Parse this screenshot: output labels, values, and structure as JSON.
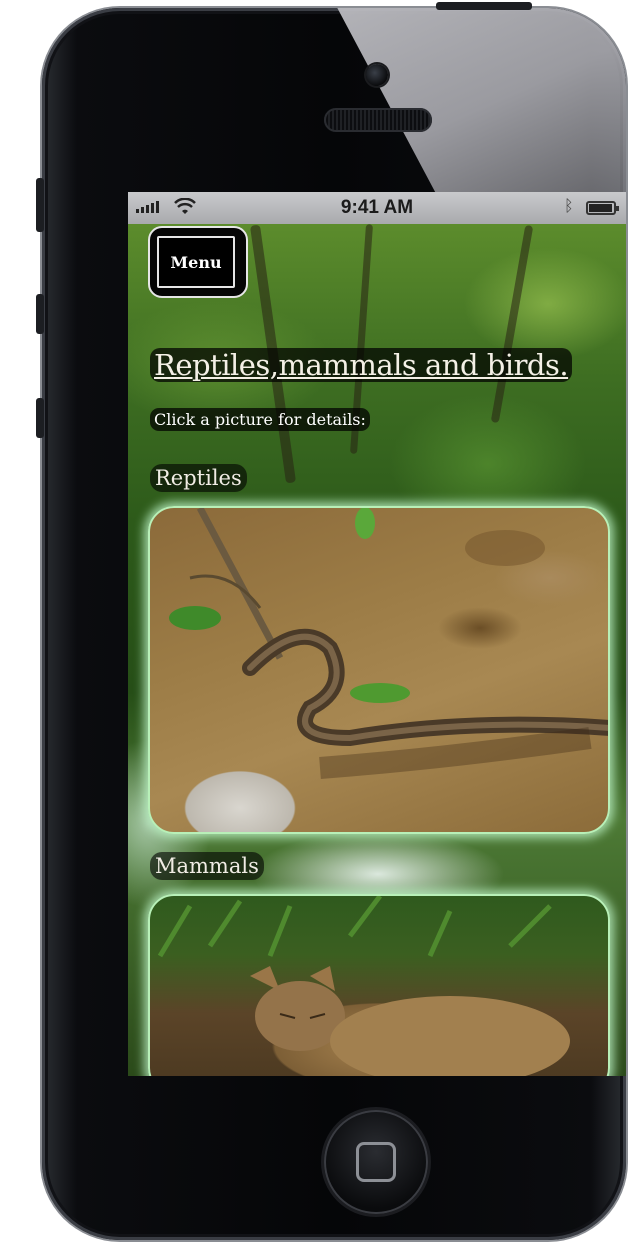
{
  "status_bar": {
    "time": "9:41 AM",
    "signal_bars": 4,
    "battery_level": 0.95
  },
  "menu": {
    "label": "Menu"
  },
  "page": {
    "title": "Reptiles,mammals and birds.",
    "instructions": "Click a picture for details:"
  },
  "sections": [
    {
      "label": "Reptiles",
      "photo": "snake-photo"
    },
    {
      "label": "Mammals",
      "photo": "cat-photo"
    }
  ],
  "colors": {
    "card_border": "#b8f0b8",
    "label_background": "#000000",
    "text": "#ffffff"
  },
  "icons": [
    "signal-icon",
    "wifi-icon",
    "bluetooth-icon",
    "battery-icon",
    "home-button-icon"
  ]
}
